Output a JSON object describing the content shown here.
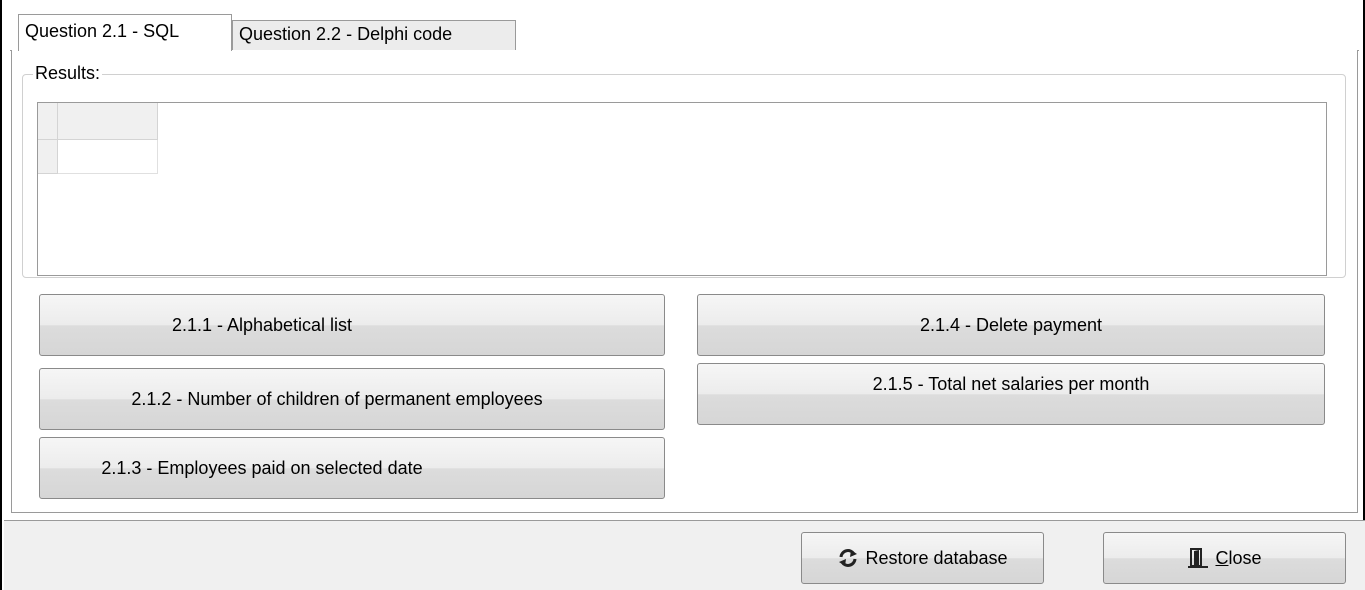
{
  "tabs": [
    {
      "label": "Question 2.1 - SQL",
      "active": true
    },
    {
      "label": "Question 2.2 - Delphi code",
      "active": false
    }
  ],
  "results": {
    "caption": "Results:"
  },
  "sql_buttons": {
    "b211": "2.1.1 - Alphabetical list",
    "b212": "2.1.2 - Number of children of permanent employees",
    "b213": "2.1.3 - Employees paid on selected date",
    "b214": "2.1.4 - Delete payment",
    "b215": "2.1.5 - Total net salaries per month"
  },
  "footer": {
    "restore_label": "Restore database",
    "restore_icon": "refresh-icon",
    "close_accel": "C",
    "close_rest": "lose",
    "close_icon": "door-exit-icon"
  }
}
